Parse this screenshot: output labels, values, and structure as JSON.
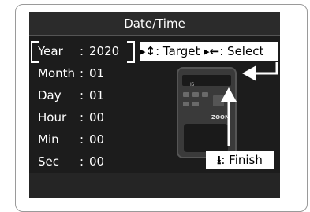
{
  "title": "Date/Time",
  "rows": [
    {
      "label": "Year",
      "sep": ":",
      "value": "2020"
    },
    {
      "label": "Month",
      "sep": ":",
      "value": "01"
    },
    {
      "label": "Day",
      "sep": ":",
      "value": "01"
    },
    {
      "label": "Hour",
      "sep": ":",
      "value": "00"
    },
    {
      "label": "Min",
      "sep": ":",
      "value": "00"
    },
    {
      "label": "Sec",
      "sep": ":",
      "value": "00"
    }
  ],
  "hints": {
    "target_glyph": "▸↕",
    "target_label": ": Target",
    "select_glyph": "▸←",
    "select_label": ": Select",
    "finish_glyph": "⭳",
    "finish_label": ": Finish"
  },
  "device": {
    "model_text": "H6",
    "logo_text": "ZOOM"
  }
}
